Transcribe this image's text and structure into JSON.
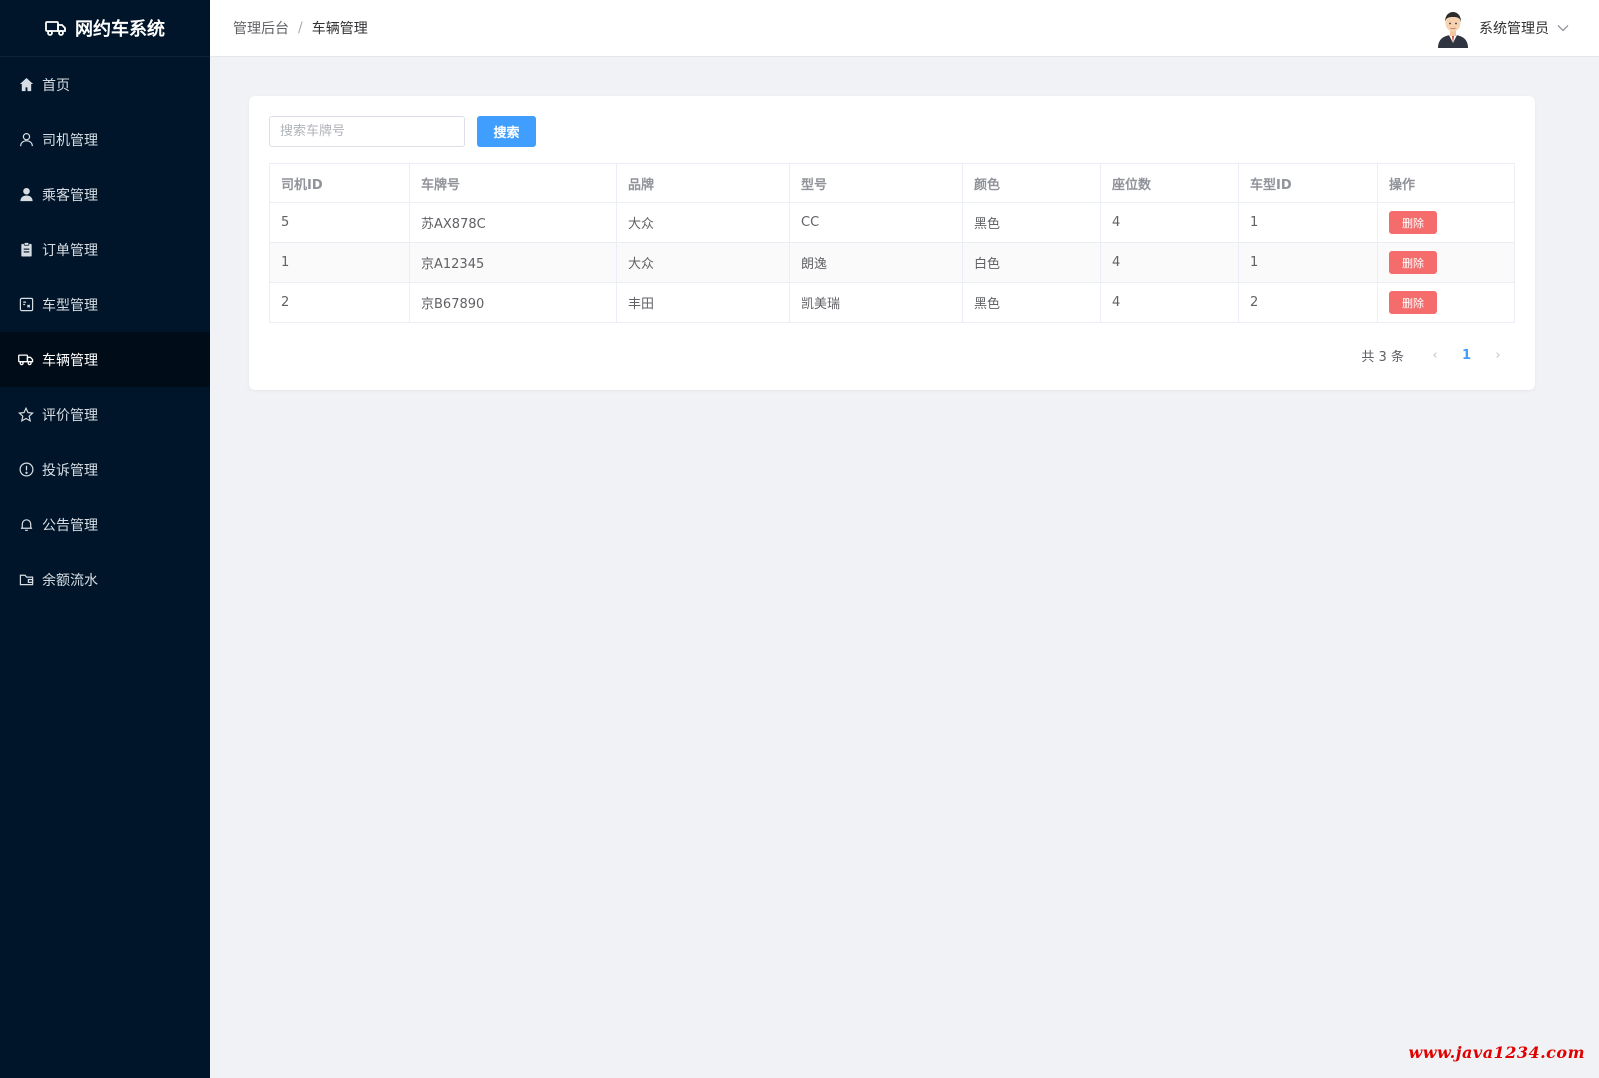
{
  "app": {
    "title": "网约车系统"
  },
  "sidebar": {
    "items": [
      {
        "label": "首页",
        "icon": "home-icon"
      },
      {
        "label": "司机管理",
        "icon": "user-outline-icon"
      },
      {
        "label": "乘客管理",
        "icon": "user-solid-icon"
      },
      {
        "label": "订单管理",
        "icon": "clipboard-icon"
      },
      {
        "label": "车型管理",
        "icon": "ticket-icon"
      },
      {
        "label": "车辆管理",
        "icon": "truck-icon",
        "active": true
      },
      {
        "label": "评价管理",
        "icon": "star-icon"
      },
      {
        "label": "投诉管理",
        "icon": "warning-circle-icon"
      },
      {
        "label": "公告管理",
        "icon": "bell-icon"
      },
      {
        "label": "余额流水",
        "icon": "wallet-icon"
      }
    ]
  },
  "header": {
    "breadcrumb": [
      "管理后台",
      "车辆管理"
    ],
    "separator": "/",
    "user_name": "系统管理员"
  },
  "search": {
    "placeholder": "搜索车牌号",
    "value": "",
    "button_label": "搜索"
  },
  "table": {
    "columns": [
      "司机ID",
      "车牌号",
      "品牌",
      "型号",
      "颜色",
      "座位数",
      "车型ID",
      "操作"
    ],
    "rows": [
      {
        "driver_id": "5",
        "plate": "苏AX878C",
        "brand": "大众",
        "model": "CC",
        "color": "黑色",
        "seats": "4",
        "type_id": "1",
        "action": "删除"
      },
      {
        "driver_id": "1",
        "plate": "京A12345",
        "brand": "大众",
        "model": "朗逸",
        "color": "白色",
        "seats": "4",
        "type_id": "1",
        "action": "删除"
      },
      {
        "driver_id": "2",
        "plate": "京B67890",
        "brand": "丰田",
        "model": "凯美瑞",
        "color": "黑色",
        "seats": "4",
        "type_id": "2",
        "action": "删除"
      }
    ]
  },
  "pagination": {
    "total_text": "共 3 条",
    "current_page": "1",
    "prev": "‹",
    "next": "›"
  },
  "watermark": "www.java1234.com",
  "colors": {
    "sidebar_bg": "#001529",
    "primary": "#409eff",
    "danger": "#f56c6c",
    "page_bg": "#f0f2f5"
  }
}
